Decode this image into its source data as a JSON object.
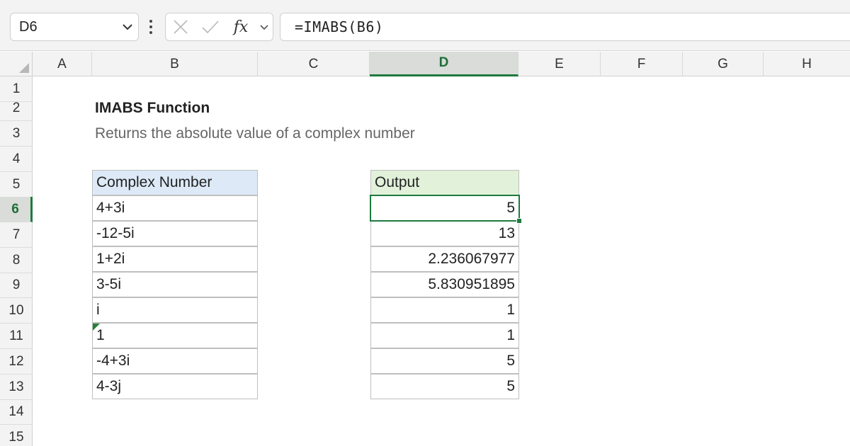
{
  "formula_bar": {
    "name_box": "D6",
    "fx_label": "fx",
    "formula": "=IMABS(B6)"
  },
  "grid": {
    "selected_cell": "D6",
    "active_column": "D",
    "active_row": "6",
    "columns": [
      "A",
      "B",
      "C",
      "D",
      "E",
      "F",
      "G",
      "H"
    ],
    "rows": [
      "1",
      "2",
      "3",
      "4",
      "5",
      "6",
      "7",
      "8",
      "9",
      "10",
      "11",
      "12",
      "13",
      "14",
      "15"
    ]
  },
  "sheet": {
    "title": "IMABS Function",
    "subtitle": "Returns the absolute value of a complex number",
    "input_header": "Complex Number",
    "output_header": "Output",
    "table_rows": [
      {
        "input": "4+3i",
        "output": "5"
      },
      {
        "input": "-12-5i",
        "output": "13"
      },
      {
        "input": "1+2i",
        "output": "2.236067977"
      },
      {
        "input": "3-5i",
        "output": "5.830951895"
      },
      {
        "input": "i",
        "output": "1"
      },
      {
        "input": "1",
        "output": "1"
      },
      {
        "input": "-4+3i",
        "output": "5"
      },
      {
        "input": "4-3j",
        "output": "5"
      }
    ]
  },
  "colors": {
    "accent_green": "#1e7a3e",
    "input_header_bg": "#dde9f7",
    "output_header_bg": "#e1f1da"
  }
}
